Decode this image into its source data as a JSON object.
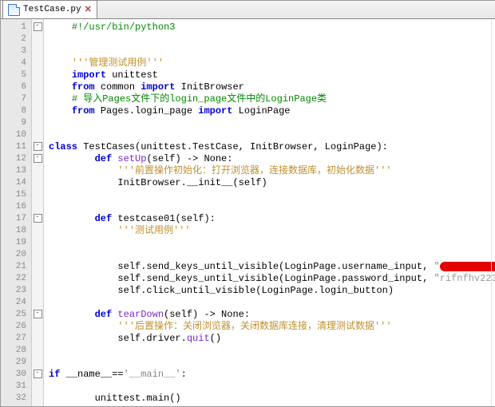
{
  "tab": {
    "filename": "TestCase.py"
  },
  "gutter": {
    "lines": 32
  },
  "fold": {
    "marks": {
      "1": "-",
      "11": "-",
      "12": "-",
      "17": "-",
      "25": "-",
      "30": "-"
    }
  },
  "code": {
    "l1_shebang": "#!/usr/bin/python3",
    "l4_doc": "'''管理测试用例'''",
    "l5_import": "import",
    "l5_mod": " unittest",
    "l6_from": "from",
    "l6_mod": " common ",
    "l6_import": "import",
    "l6_name": " InitBrowser",
    "l7_comment": "# 导入Pages文件下的login_page文件中的LoginPage类",
    "l8_from": "from",
    "l8_mod": " Pages.login_page ",
    "l8_import": "import",
    "l8_name": " LoginPage",
    "l11_class": "class",
    "l11_rest": " TestCases(unittest.TestCase, InitBrowser, LoginPage):",
    "l12_def": "def",
    "l12_name": " setUp",
    "l12_sig": "(self) -> None:",
    "l13_doc": "'''前置操作初始化：打开浏览器，连接数据库，初始化数据'''",
    "l14": "InitBrowser.__init__(self)",
    "l17_def": "def",
    "l17_name": " testcase01",
    "l17_sig": "(self):",
    "l18_doc": "'''测试用例'''",
    "l21a": "self.send_keys_until_visible(LoginPage.username_input, ",
    "l21q1": "\"",
    "l21q2": "\")",
    "l22a": "self.send_keys_until_visible(LoginPage.password_input, ",
    "l22q": "\"",
    "l22pw": "rifnfhv223",
    "l22e": "\")",
    "l23": "self.click_until_visible(LoginPage.login_button)",
    "l25_def": "def",
    "l25_name": " tearDown",
    "l25_sig": "(self) -> None:",
    "l26_doc": "'''后置操作：关闭浏览器，关闭数据库连接，清理测试数据'''",
    "l27a": "self.driver.",
    "l27b": "quit",
    "l27c": "()",
    "l30_if": "if",
    "l30_name": " __name__",
    "l30_eq": "==",
    "l30_main": "'__main__'",
    "l30_colon": ":",
    "l32": "unittest.main()"
  }
}
